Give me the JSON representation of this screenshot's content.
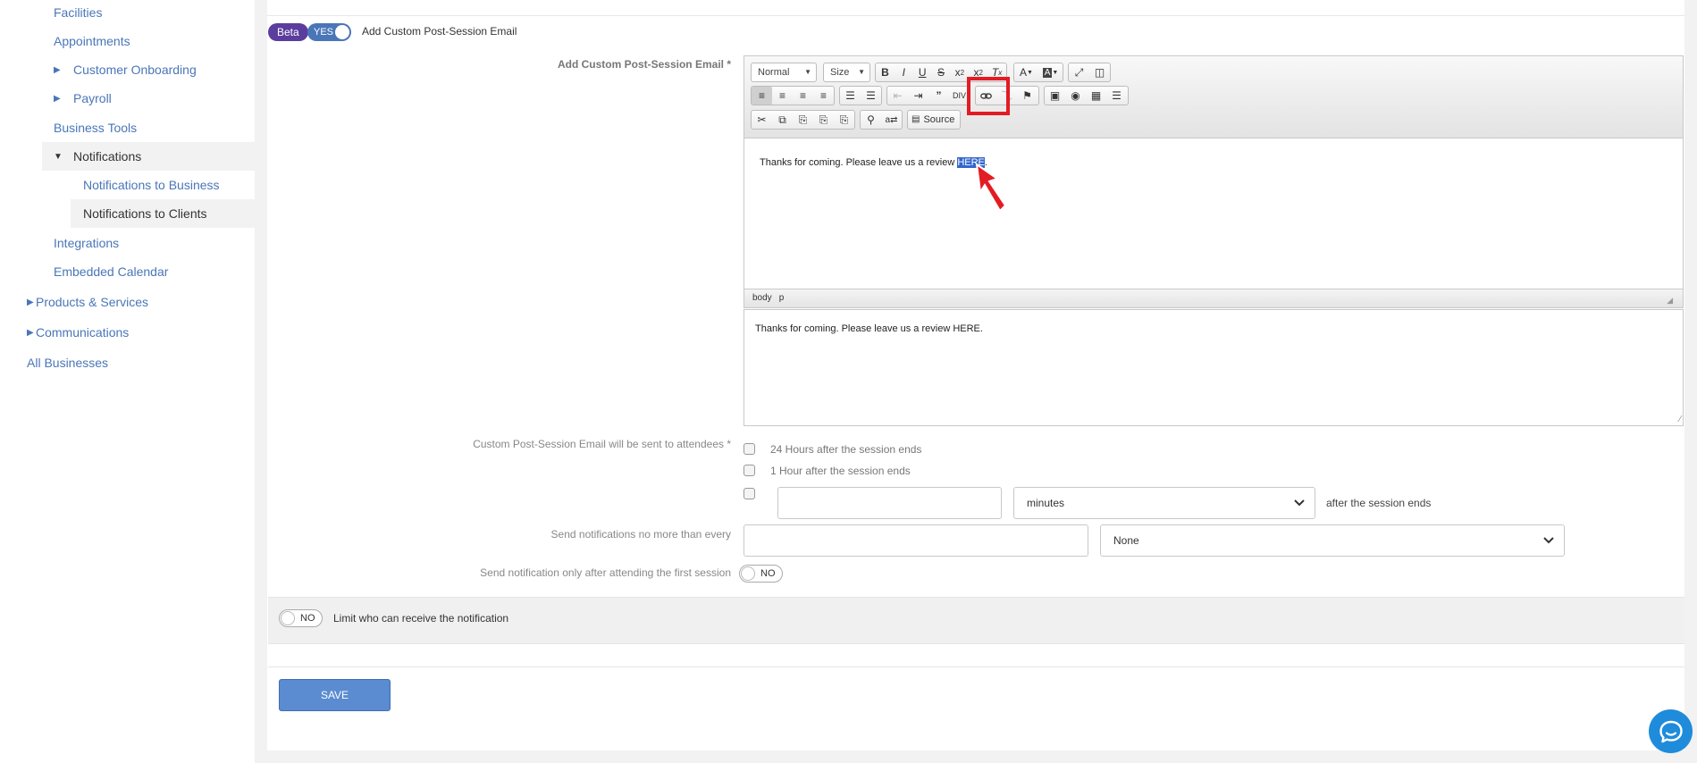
{
  "sidebar": {
    "items": [
      {
        "label": "Facilities"
      },
      {
        "label": "Appointments"
      },
      {
        "label": "Customer Onboarding"
      },
      {
        "label": "Payroll"
      },
      {
        "label": "Business Tools"
      },
      {
        "label": "Notifications"
      },
      {
        "label": "Notifications to Business"
      },
      {
        "label": "Notifications to Clients"
      },
      {
        "label": "Integrations"
      },
      {
        "label": "Embedded Calendar"
      },
      {
        "label": "Products & Services"
      },
      {
        "label": "Communications"
      },
      {
        "label": "All Businesses"
      }
    ]
  },
  "header": {
    "beta_badge": "Beta",
    "toggle_label": "YES",
    "title": "Add Custom Post-Session Email"
  },
  "editor": {
    "label": "Add Custom Post-Session Email *",
    "format_combo": "Normal",
    "size_combo": "Size",
    "source_label": "Source",
    "content_text": "Thanks for coming. Please leave us a review ",
    "content_selected": "HERE",
    "content_after": ".",
    "status_path": [
      "body",
      "p"
    ],
    "preview_text": "Thanks for coming. Please leave us a review HERE."
  },
  "schedule": {
    "label": "Custom Post-Session Email will be sent to attendees *",
    "options": [
      "24 Hours after the session ends",
      "1 Hour after the session ends"
    ],
    "custom_unit": "minutes",
    "custom_suffix": "after the session ends"
  },
  "frequency": {
    "label": "Send notifications no more than every",
    "select_value": "None"
  },
  "first_session": {
    "label": "Send notification only after attending the first session",
    "toggle_label": "NO"
  },
  "limit": {
    "toggle_label": "NO",
    "label": "Limit who can receive the notification"
  },
  "actions": {
    "save_label": "SAVE"
  },
  "colors": {
    "accent": "#4a76b8",
    "beta": "#5b3d9e",
    "highlight": "#e31b23",
    "selection": "#3366cc",
    "chat": "#1f8bdb"
  }
}
